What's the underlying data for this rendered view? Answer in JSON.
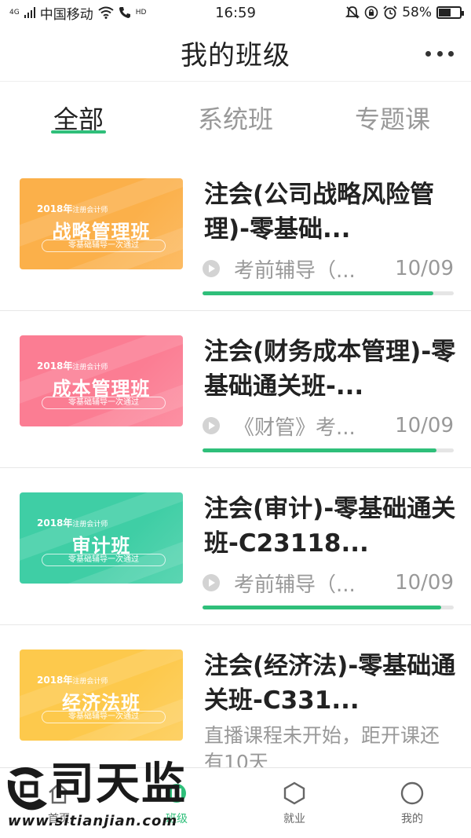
{
  "status_bar": {
    "signal": "4G",
    "carrier": "中国移动",
    "hd": "HD",
    "time": "16:59",
    "battery_text": "58%",
    "battery_level": 0.58
  },
  "header": {
    "title": "我的班级"
  },
  "tabs": [
    {
      "label": "全部",
      "active": true
    },
    {
      "label": "系统班",
      "active": false
    },
    {
      "label": "专题课",
      "active": false
    }
  ],
  "courses": [
    {
      "thumb": {
        "year": "2018年",
        "cert": "注册会计师",
        "name": "战略管理班",
        "tagline": "零基础辅导一次通过",
        "color": "#fbb04a"
      },
      "title": "注会(公司战略风险管理)-零基础...",
      "meta": "考前辅导（...",
      "date": "10/09",
      "progress": 0.92
    },
    {
      "thumb": {
        "year": "2018年",
        "cert": "注册会计师",
        "name": "成本管理班",
        "tagline": "零基础辅导一次通过",
        "color": "#fb7d93"
      },
      "title": "注会(财务成本管理)-零基础通关班-...",
      "meta": "《财管》考...",
      "date": "10/09",
      "progress": 0.93
    },
    {
      "thumb": {
        "year": "2018年",
        "cert": "注册会计师",
        "name": "审计班",
        "tagline": "零基础辅导一次通过",
        "color": "#3fcea5"
      },
      "title": "注会(审计)-零基础通关班-C23118...",
      "meta": "考前辅导（...",
      "date": "10/09",
      "progress": 0.95
    },
    {
      "thumb": {
        "year": "2018年",
        "cert": "注册会计师",
        "name": "经济法班",
        "tagline": "零基础辅导一次通过",
        "color": "#fdc94c"
      },
      "title": "注会(经济法)-零基础通关班-C331...",
      "status": "直播课程未开始，距开课还有10天"
    }
  ],
  "bottom_nav": [
    {
      "label": "首页",
      "icon": "home-icon",
      "active": false
    },
    {
      "label": "班级",
      "icon": "class-icon",
      "active": true
    },
    {
      "label": "就业",
      "icon": "hexagon-icon",
      "active": false
    },
    {
      "label": "我的",
      "icon": "profile-icon",
      "active": false
    }
  ],
  "watermark": {
    "brand": "司天监",
    "url": "www.sitianjian.com"
  },
  "colors": {
    "accent": "#2fbf7a"
  }
}
